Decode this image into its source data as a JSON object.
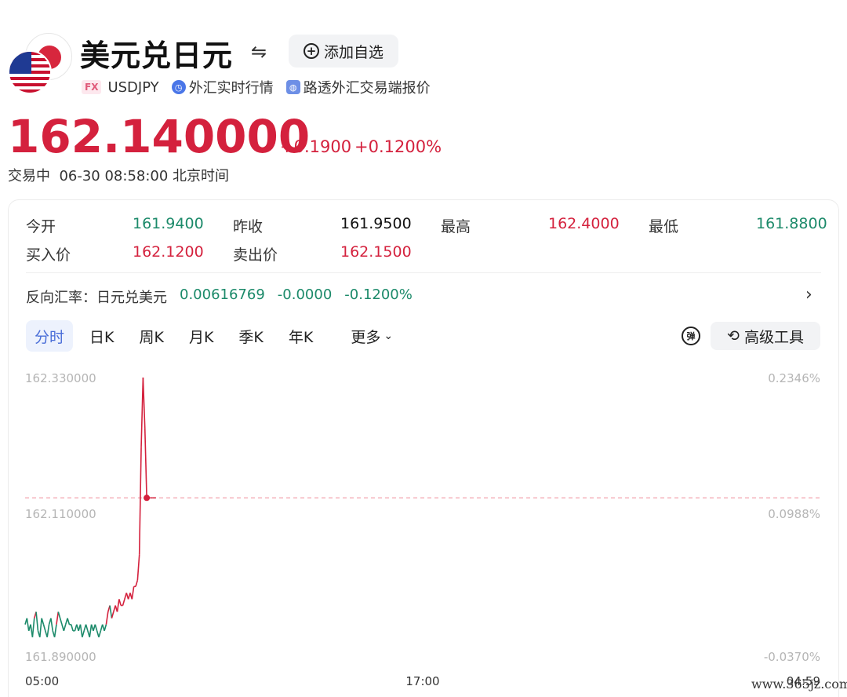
{
  "header": {
    "title": "美元兑日元",
    "add_label": "添加自选",
    "fx_badge": "FX",
    "symbol": "USDJPY",
    "realtime_label": "外汇实时行情",
    "reuters_label": "路透外汇交易端报价"
  },
  "quote": {
    "price": "162.140000",
    "change": "+0.1900",
    "change_pct": "+0.1200%",
    "status": "交易中",
    "time": "06-30 08:58:00 北京时间"
  },
  "stats": {
    "open_label": "今开",
    "open": "161.9400",
    "prev_label": "昨收",
    "prev": "161.9500",
    "high_label": "最高",
    "high": "162.4000",
    "low_label": "最低",
    "low": "161.8800",
    "bid_label": "买入价",
    "bid": "162.1200",
    "ask_label": "卖出价",
    "ask": "162.1500"
  },
  "reverse": {
    "label": "反向汇率：日元兑美元",
    "rate": "0.00616769",
    "change": "-0.0000",
    "change_pct": "-0.1200%"
  },
  "tabs": [
    "分时",
    "日K",
    "周K",
    "月K",
    "季K",
    "年K"
  ],
  "tab_more": "更多",
  "tools_label": "高级工具",
  "colors": {
    "up": "#d4213d",
    "down": "#1c8a6a",
    "accent": "#4a6ed8"
  },
  "chart_data": {
    "type": "line",
    "ylim": [
      161.89,
      162.33
    ],
    "y_ticks_left": [
      "162.330000",
      "162.110000",
      "161.890000"
    ],
    "y_ticks_right": [
      "0.2346%",
      "0.0988%",
      "-0.0370%"
    ],
    "x_ticks": [
      "05:00",
      "17:00",
      "04:59"
    ],
    "reference": 162.14,
    "x": [
      0,
      1,
      2,
      3,
      4,
      5,
      6,
      7,
      8,
      9,
      10,
      11,
      12,
      13,
      14,
      15,
      16,
      17,
      18,
      19,
      20,
      21,
      22,
      23,
      24,
      25,
      26,
      27,
      28,
      29,
      30,
      31,
      32,
      33,
      34,
      35,
      36,
      37,
      38,
      39,
      40,
      41,
      42,
      43,
      44,
      45,
      46,
      47,
      48,
      49,
      50,
      51,
      52,
      53,
      54,
      55,
      56,
      57,
      58,
      59,
      60,
      61,
      62,
      63,
      64,
      65,
      66,
      67,
      68,
      69,
      70,
      71
    ],
    "values": [
      161.94,
      161.95,
      161.93,
      161.94,
      161.92,
      161.95,
      161.96,
      161.93,
      161.92,
      161.95,
      161.94,
      161.93,
      161.92,
      161.94,
      161.95,
      161.93,
      161.92,
      161.94,
      161.96,
      161.95,
      161.94,
      161.93,
      161.94,
      161.95,
      161.94,
      161.94,
      161.93,
      161.93,
      161.94,
      161.93,
      161.94,
      161.92,
      161.93,
      161.94,
      161.93,
      161.92,
      161.94,
      161.93,
      161.94,
      161.93,
      161.92,
      161.93,
      161.94,
      161.93,
      161.94,
      161.96,
      161.97,
      161.95,
      161.96,
      161.97,
      161.96,
      161.98,
      161.97,
      161.97,
      161.98,
      161.99,
      161.98,
      161.99,
      161.98,
      162.0,
      162.0,
      162.01,
      162.05,
      162.22,
      162.33,
      162.25,
      162.14,
      162.14,
      162.14,
      162.14,
      162.14,
      162.14
    ]
  },
  "watermark": "www.365jz.com"
}
